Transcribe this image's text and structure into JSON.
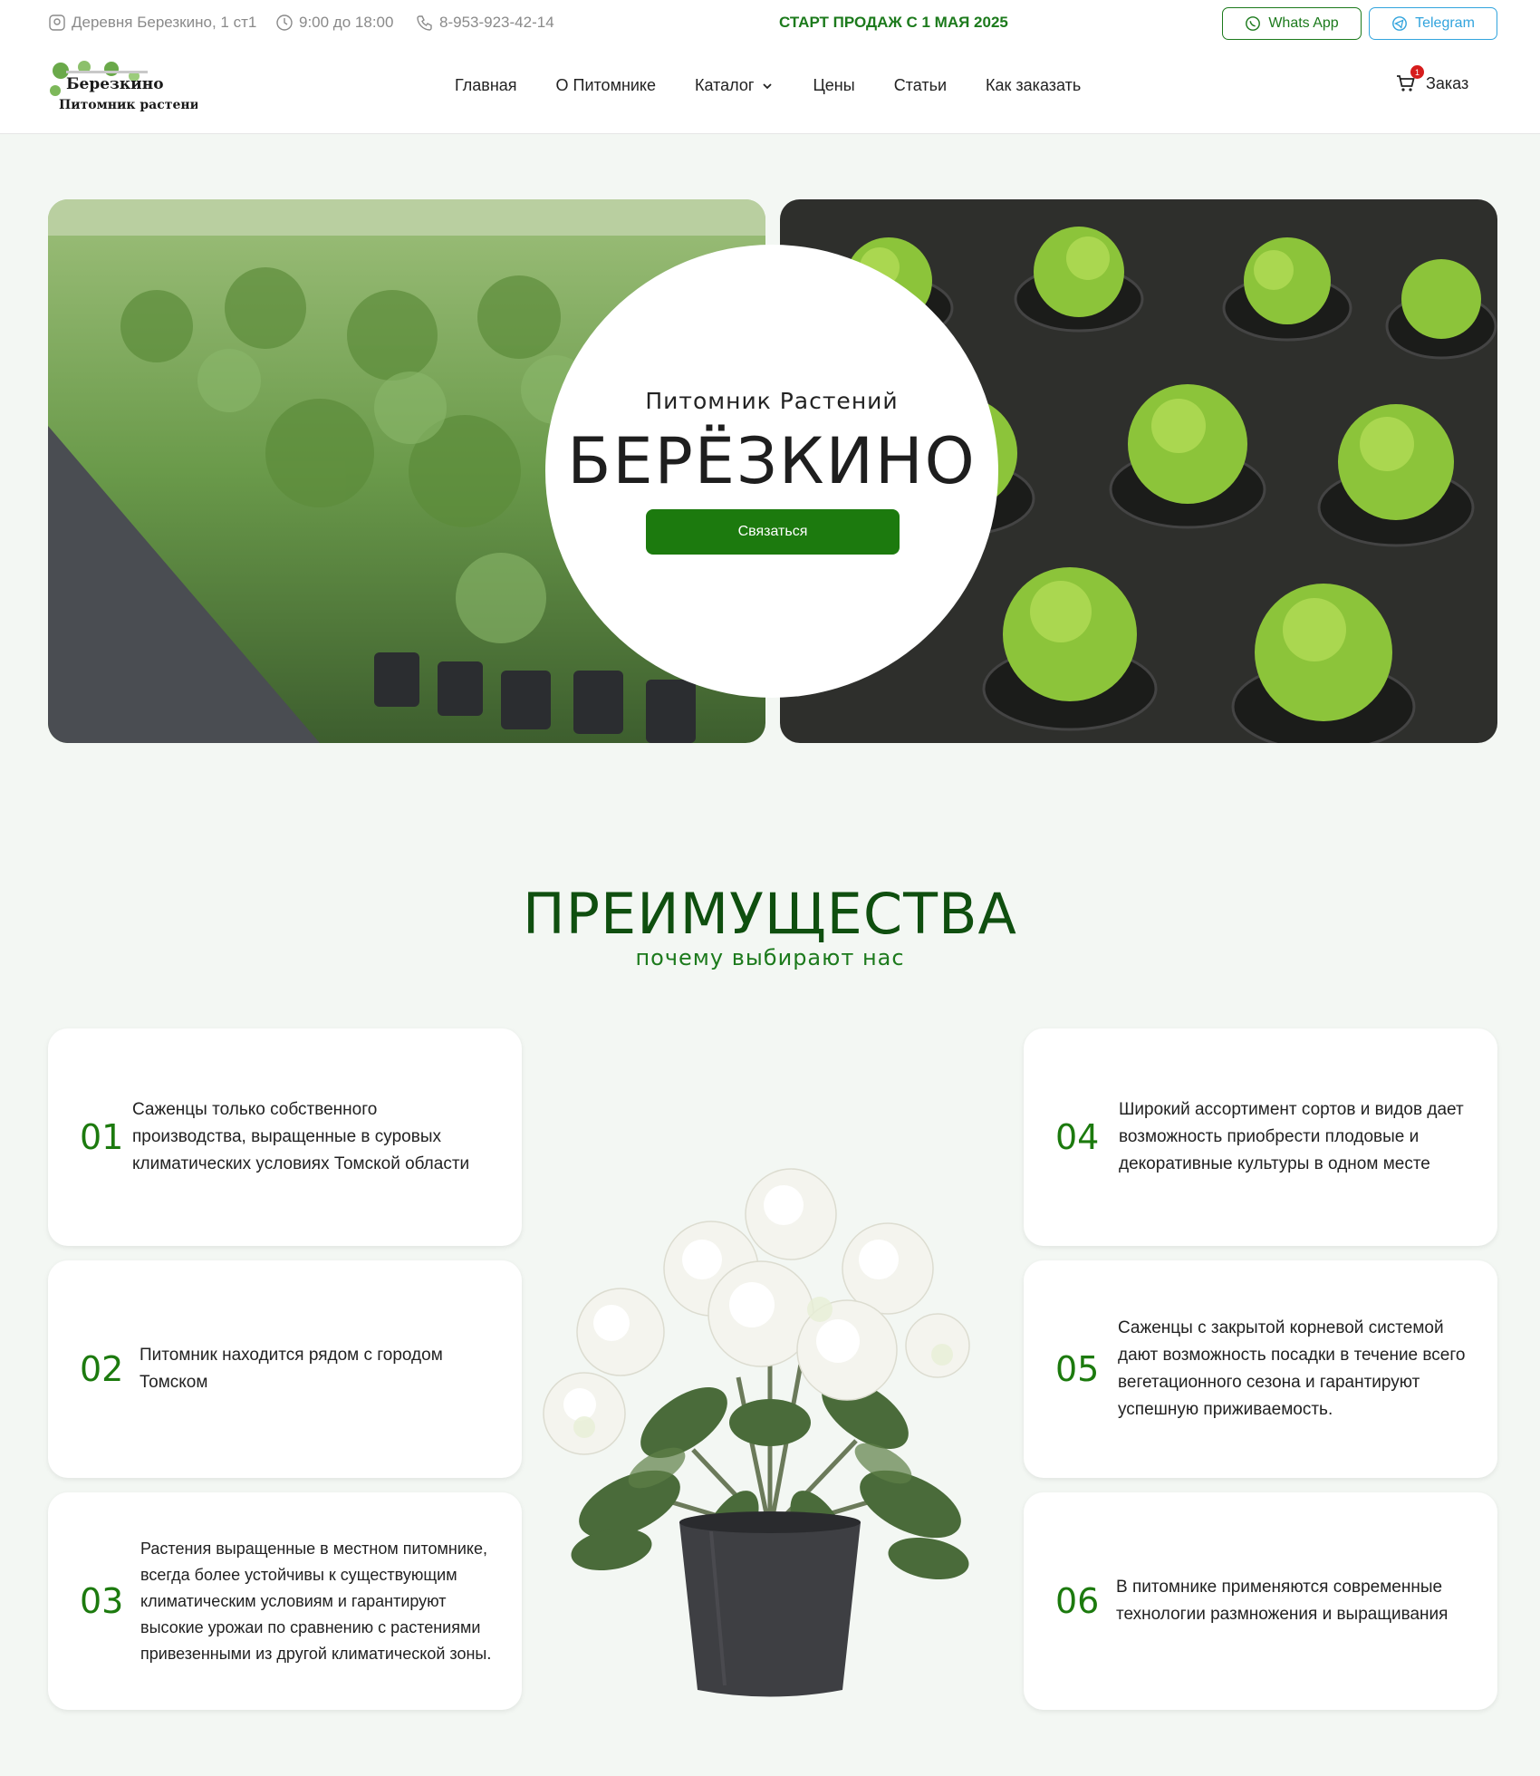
{
  "topbar": {
    "address": "Деревня Березкино, 1 ст1",
    "hours": "9:00 до 18:00",
    "phone": "8-953-923-42-14",
    "promo": "СТАРТ ПРОДАЖ С 1 МАЯ 2025",
    "whatsapp_label": "Whats App",
    "telegram_label": "Telegram"
  },
  "logo": {
    "line1": "Березкино",
    "line2": "Питомник растений"
  },
  "nav": {
    "items": [
      "Главная",
      "О Питомнике",
      "Каталог",
      "Цены",
      "Статьи",
      "Как заказать"
    ]
  },
  "cart": {
    "label": "Заказ",
    "count": "1"
  },
  "hero": {
    "subtitle": "Питомник Растений",
    "title": "БЕРЁЗКИНО",
    "button": "Связаться"
  },
  "advantages": {
    "title": "ПРЕИМУЩЕСТВА",
    "subtitle": "почему выбирают нас",
    "items": [
      {
        "num": "01",
        "text": "Саженцы только собственного производства, выращенные в суровых климатических условиях Томской области"
      },
      {
        "num": "02",
        "text": "Питомник находится рядом с городом Томском"
      },
      {
        "num": "03",
        "text": "Растения выращенные в местном питомнике, всегда более устойчивы к существующим климатическим условиям и гарантируют высокие урожаи по сравнению с растениями привезенными из другой климатической зоны."
      },
      {
        "num": "04",
        "text": "Широкий ассортимент сортов и видов дает возможность приобрести плодовые и декоративные культуры в одном месте"
      },
      {
        "num": "05",
        "text": "Саженцы с закрытой корневой системой дают возможность посадки в течение всего вегетационного сезона и гарантируют успешную приживаемость."
      },
      {
        "num": "06",
        "text": "В питомнике применяются современные технологии размножения и выращивания"
      }
    ]
  },
  "colors": {
    "brand_green": "#1c7a0e",
    "dark_green": "#0f4f0f",
    "telegram": "#32a4dd",
    "badge": "#d61d1d"
  }
}
